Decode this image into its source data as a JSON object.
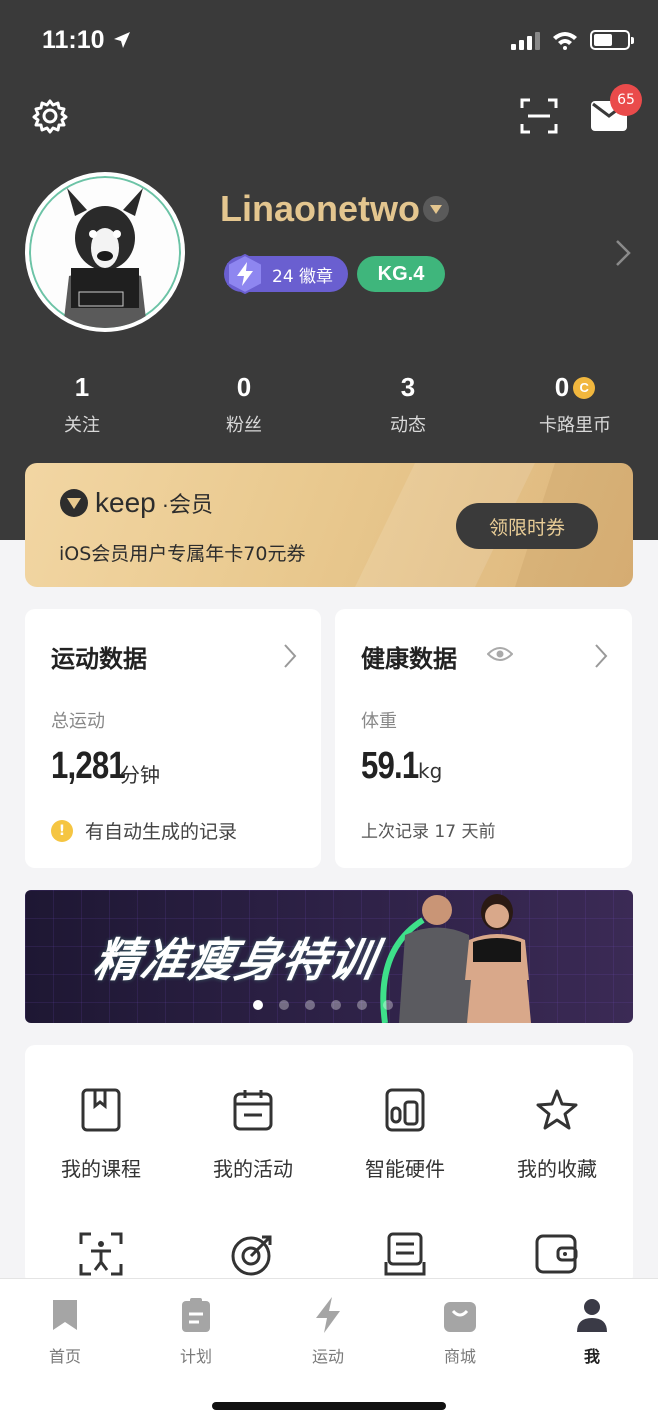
{
  "status_bar": {
    "time": "11:10"
  },
  "header": {
    "mail_badge": "65",
    "username": "Linaonetwo",
    "badges_label": "24 徽章",
    "level_label": "KG.4"
  },
  "stats": [
    {
      "value": "1",
      "label": "关注"
    },
    {
      "value": "0",
      "label": "粉丝"
    },
    {
      "value": "3",
      "label": "动态"
    },
    {
      "value": "0",
      "label": "卡路里币",
      "coin": "C"
    }
  ],
  "membership": {
    "brand": "keep",
    "brand_suffix": "·会员",
    "description": "iOS会员用户专属年卡70元券",
    "button": "领限时券"
  },
  "sport_card": {
    "title": "运动数据",
    "subtitle": "总运动",
    "value": "1,281",
    "unit": "分钟",
    "note": "有自动生成的记录"
  },
  "health_card": {
    "title": "健康数据",
    "subtitle": "体重",
    "value": "59.1",
    "unit": "kg",
    "note": "上次记录 17 天前"
  },
  "banner": {
    "title": "精准瘦身特训",
    "slides": 6,
    "active_slide": 0
  },
  "menu": [
    {
      "label": "我的课程",
      "icon": "bookmark-book-icon"
    },
    {
      "label": "我的活动",
      "icon": "calendar-icon"
    },
    {
      "label": "智能硬件",
      "icon": "devices-icon"
    },
    {
      "label": "我的收藏",
      "icon": "star-icon"
    },
    {
      "label": "",
      "icon": "body-scan-icon"
    },
    {
      "label": "",
      "icon": "target-icon"
    },
    {
      "label": "",
      "icon": "list-inbox-icon"
    },
    {
      "label": "",
      "icon": "wallet-icon"
    }
  ],
  "tabs": [
    {
      "label": "首页",
      "icon": "bookmark-icon"
    },
    {
      "label": "计划",
      "icon": "plan-icon"
    },
    {
      "label": "运动",
      "icon": "lightning-icon"
    },
    {
      "label": "商城",
      "icon": "shopping-bag-icon"
    },
    {
      "label": "我",
      "icon": "person-icon",
      "active": true
    }
  ]
}
